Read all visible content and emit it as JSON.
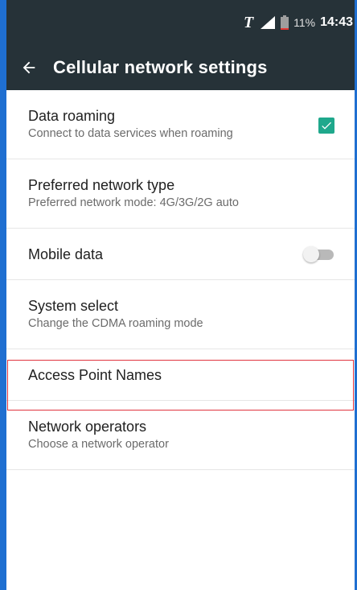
{
  "status_bar": {
    "carrier_icon": "T",
    "signal_icon": "signal-icon",
    "battery_icon": "battery-icon",
    "battery_level": 0.11,
    "battery_percent": "11%",
    "time": "14:43"
  },
  "app_bar": {
    "back_icon": "arrow-back-icon",
    "title": "Cellular network settings"
  },
  "settings": {
    "data_roaming": {
      "title": "Data roaming",
      "subtitle": "Connect to data services when roaming",
      "checked": true
    },
    "preferred_network": {
      "title": "Preferred network type",
      "subtitle": "Preferred network mode: 4G/3G/2G auto"
    },
    "mobile_data": {
      "title": "Mobile data",
      "enabled": false
    },
    "system_select": {
      "title": "System select",
      "subtitle": "Change the CDMA roaming mode"
    },
    "access_point_names": {
      "title": "Access Point Names"
    },
    "network_operators": {
      "title": "Network operators",
      "subtitle": "Choose a network operator"
    }
  },
  "colors": {
    "app_bar": "#263238",
    "accent": "#1fa88c",
    "highlight": "#e0343f",
    "frame": "#1f6fd1"
  }
}
